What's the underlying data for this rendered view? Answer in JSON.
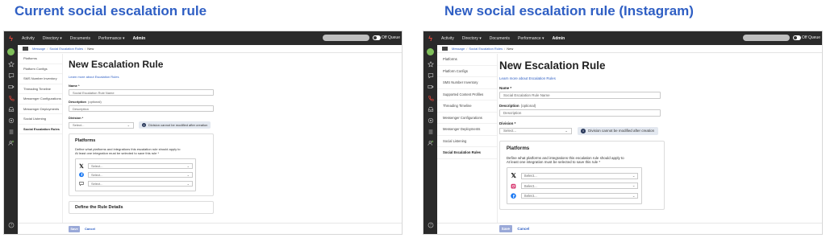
{
  "headings": {
    "left": "Current social escalation rule",
    "right": "New social escalation rule (Instagram)"
  },
  "colors": {
    "heading": "#2f5fc4",
    "topbar": "#2a2a2a",
    "accent": "#2f5fc4",
    "logo": "#e0453a"
  },
  "topbar": {
    "nav": [
      "Activity",
      "Directory ▾",
      "Documents",
      "Performance ▾",
      "Admin"
    ],
    "active": "Admin",
    "queue_label": "Off Queue"
  },
  "rail_icons": [
    "avatar",
    "star-icon",
    "chat-icon",
    "video-icon",
    "phone-icon",
    "inbox-icon",
    "grid-icon",
    "list-icon",
    "person-add-icon",
    "help-icon"
  ],
  "breadcrumb": {
    "items": [
      "Message",
      "Social Escalation Rules",
      "New"
    ]
  },
  "left": {
    "subnav": [
      "Platforms",
      "Platform Configs",
      "SMS Number Inventory",
      "Threading Timeline",
      "Messenger Configurations",
      "Messenger Deployments",
      "Social Listening",
      "Social Escalation Rules"
    ],
    "platform_icons": [
      "x-icon",
      "facebook-icon",
      "message-icon"
    ]
  },
  "right": {
    "subnav": [
      "Platforms",
      "Platform Configs",
      "SMS Number Inventory",
      "Supported Content Profiles",
      "Threading Timeline",
      "Messenger Configurations",
      "Messenger Deployments",
      "Social Listening",
      "Social Escalation Rules"
    ],
    "platform_icons": [
      "x-icon",
      "instagram-icon",
      "facebook-icon"
    ]
  },
  "form": {
    "title": "New Escalation Rule",
    "learn_more": "Learn more about Escalation Rules",
    "name_label": "Name *",
    "name_value": "Social Escalation Rule Name",
    "description_label": "Description",
    "description_optional": "(optional)",
    "description_value": "Description",
    "division_label": "Division *",
    "division_value": "Select...",
    "division_note": "Division cannot be modified after creation",
    "platforms_title": "Platforms",
    "platforms_desc_1": "Define what platforms and integrations this escalation rule should apply to",
    "platforms_desc_2": "At least one integration must be selected to save this rule *",
    "select_placeholder": "Select...",
    "next_section": "Define the Rule Details"
  },
  "footer": {
    "save": "Save",
    "cancel": "Cancel"
  }
}
